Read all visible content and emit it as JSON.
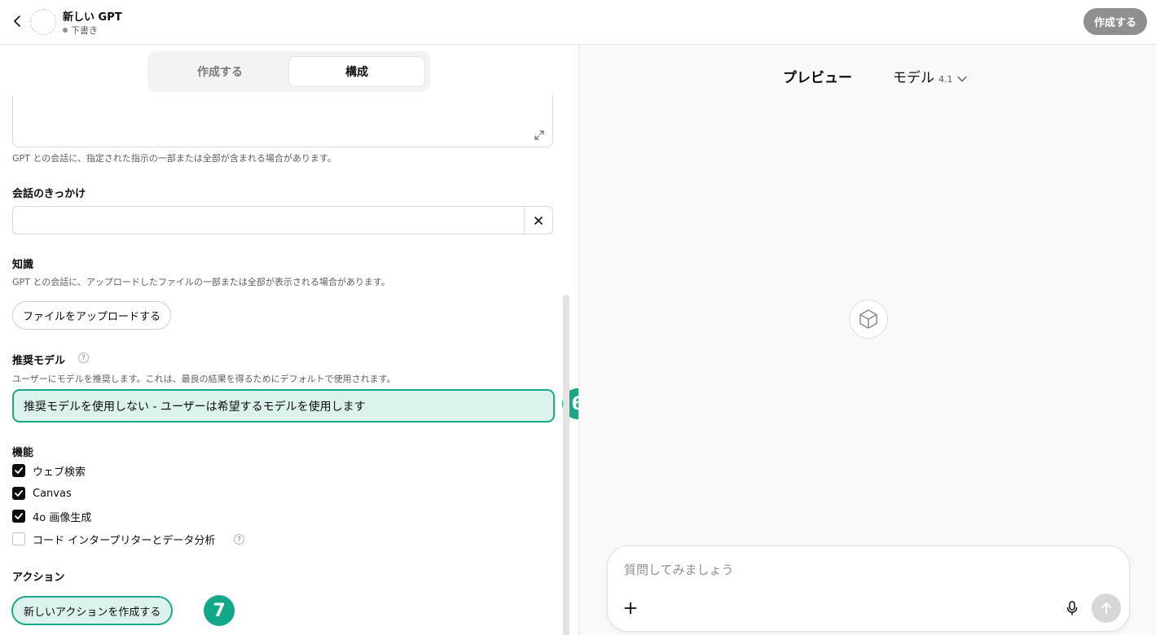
{
  "header": {
    "title": "新しい GPT",
    "status": "下書き",
    "create_label": "作成する"
  },
  "tabs": [
    {
      "label": "作成する",
      "active": false
    },
    {
      "label": "構成",
      "active": true
    }
  ],
  "instructions": {
    "hint": "GPT との会話に、指定された指示の一部または全部が含まれる場合があります。"
  },
  "conversation_starters": {
    "label": "会話のきっかけ",
    "value": ""
  },
  "knowledge": {
    "label": "知識",
    "hint": "GPT との会話に、アップロードしたファイルの一部または全部が表示される場合があります。",
    "upload_label": "ファイルをアップロードする"
  },
  "recommended_model": {
    "label": "推奨モデル",
    "hint": "ユーザーにモデルを推奨します。これは、最良の結果を得るためにデフォルトで使用されます。",
    "selected": "推奨モデルを使用しない - ユーザーは希望するモデルを使用します",
    "badge": "6"
  },
  "capabilities": {
    "label": "機能",
    "items": [
      {
        "label": "ウェブ検索",
        "checked": true
      },
      {
        "label": "Canvas",
        "checked": true
      },
      {
        "label": "4o 画像生成",
        "checked": true
      },
      {
        "label": "コード インタープリターとデータ分析",
        "checked": false
      }
    ]
  },
  "actions": {
    "label": "アクション",
    "new_action_label": "新しいアクションを作成する",
    "badge": "7"
  },
  "preview": {
    "title": "プレビュー",
    "model_label": "モデル",
    "model_version": "4.1",
    "placeholder": "質問してみましょう"
  },
  "colors": {
    "accent": "#17a88b",
    "accent_bg": "#dcf2ec",
    "badge": "#12a88a",
    "disabled_button": "#8f8f8f"
  },
  "help_glyph": "?"
}
